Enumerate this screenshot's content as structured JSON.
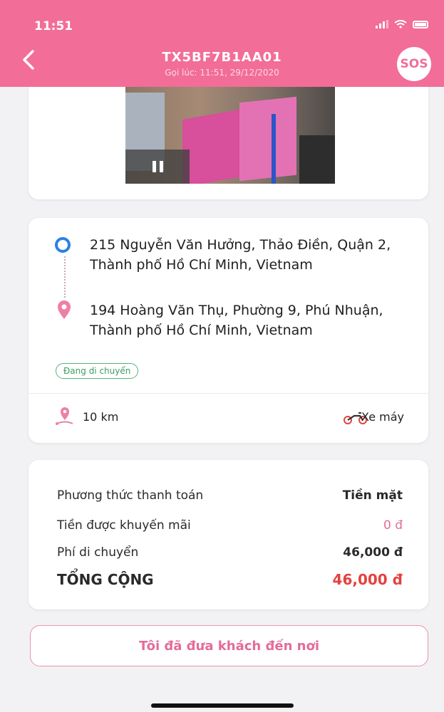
{
  "status_bar": {
    "time": "11:51"
  },
  "header": {
    "title": "TX5BF7B1AA01",
    "subtitle": "Gọi lúc: 11:51, 29/12/2020",
    "sos_label": "SOS"
  },
  "route": {
    "pickup": "215 Nguyễn Văn Hưởng, Thảo Điền, Quận 2, Thành phố Hồ Chí Minh, Vietnam",
    "destination": "194 Hoàng Văn Thụ, Phường 9, Phú Nhuận, Thành phố Hồ Chí Minh, Vietnam",
    "status": "Đang di chuyển",
    "distance": "10 km",
    "vehicle": "Xe máy"
  },
  "payment": {
    "method_label": "Phương thức thanh toán",
    "method_value": "Tiền mặt",
    "promo_label": "Tiền được khuyến mãi",
    "promo_value": "0 đ",
    "fare_label": "Phí di chuyển",
    "fare_value": "46,000 đ",
    "total_label": "TỔNG CỘNG",
    "total_value": "46,000 đ"
  },
  "action": {
    "label": "Tôi đã đưa khách đến nơi"
  },
  "colors": {
    "brand": "#f26d98",
    "total": "#e4413e",
    "status": "#3e9c63"
  }
}
